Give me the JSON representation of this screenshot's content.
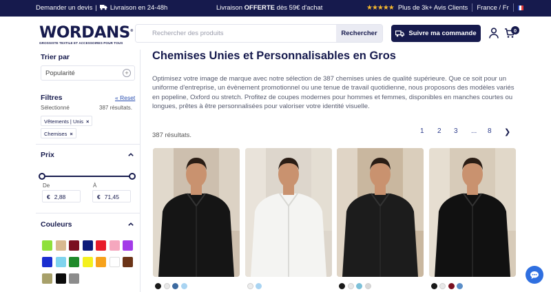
{
  "topbar": {
    "quote": "Demander un devis",
    "separator": "|",
    "delivery": "Livraison en 24-48h",
    "free_prefix": "Livraison ",
    "free_bold": "OFFERTE",
    "free_suffix": " dès 59€ d'achat",
    "reviews": "Plus de 3k+ Avis Clients",
    "locale": "France / Fr"
  },
  "header": {
    "logo": "WORDANS",
    "logo_tagline": "GROSSISTE TEXTILE ET ACCESSOIRES POUR TOUS",
    "search_placeholder": "Rechercher des produits",
    "search_button": "Rechercher",
    "track_button": "Suivre ma commande",
    "cart_count": "0"
  },
  "sidebar": {
    "sort_title": "Trier par",
    "sort_value": "Popularité",
    "filters_title": "Filtres",
    "reset": "« Reset",
    "selected_label": "Sélectionné",
    "results": "387 résultats.",
    "chips": [
      "Vêtements | Unis",
      "Chemises"
    ],
    "price_title": "Prix",
    "price_from_label": "De",
    "price_to_label": "À",
    "currency": "€",
    "price_from": "2,88",
    "price_to": "71,45",
    "colors_title": "Couleurs",
    "colors": [
      "#8ee03a",
      "#d8b98f",
      "#7a1020",
      "#0c1a7a",
      "#e81c2a",
      "#f5a7be",
      "#a33be8",
      "#1a2ed0",
      "#7fd4ee",
      "#1f8a2a",
      "#f4f01e",
      "#f7a21b",
      "#ffffff",
      "#6b3417",
      "#a7a06a",
      "#0a0a0a",
      "#8c8c8c"
    ]
  },
  "main": {
    "title": "Chemises Unies et Personnalisables en Gros",
    "description": "Optimisez votre image de marque avec notre sélection de 387 chemises unies de qualité supérieure. Que ce soit pour un uniforme d'entreprise, un évènement promotionnel ou une tenue de travail quotidienne, nous proposons des modèles variés en popeline, Oxford ou stretch. Profitez de coupes modernes pour hommes et femmes, disponibles en manches courtes ou longues, prêtes à être personnalisées pour valoriser votre identité visuelle.",
    "results": "387 résultats.",
    "pages": [
      "1",
      "2",
      "3",
      "...",
      "8"
    ],
    "next": "❯"
  },
  "products": [
    {
      "shirt_color": "#151515",
      "swatches": [
        "#1a1a1a",
        "#e8e8e8",
        "#3c6aa0",
        "#a9d4f2"
      ]
    },
    {
      "shirt_color": "#f4f4f2",
      "swatches": [
        "#ececec",
        "#a9d4f2"
      ]
    },
    {
      "shirt_color": "#1c1c1c",
      "swatches": [
        "#1a1a1a",
        "#e8e8e8",
        "#7cc0d8",
        "#d8d8d8"
      ]
    },
    {
      "shirt_color": "#111111",
      "swatches": [
        "#1a1a1a",
        "#e8e8e8",
        "#7a1020",
        "#5b8ec8"
      ]
    }
  ]
}
